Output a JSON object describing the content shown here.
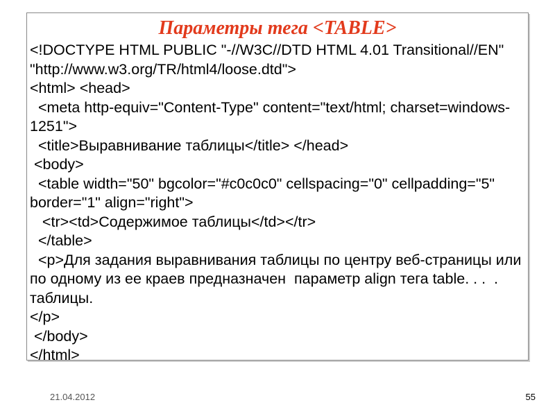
{
  "title": "Параметры тега <TABLE>",
  "code": "<!DOCTYPE HTML PUBLIC \"-//W3C//DTD HTML 4.01 Transitional//EN\" \"http://www.w3.org/TR/html4/loose.dtd\">\n<html> <head>\n  <meta http-equiv=\"Content-Type\" content=\"text/html; charset=windows-1251\">\n  <title>Выравнивание таблицы</title> </head>\n <body>\n  <table width=\"50\" bgcolor=\"#c0c0c0\" cellspacing=\"0\" cellpadding=\"5\" border=\"1\" align=\"right\">\n   <tr><td>Содержимое таблицы</td></tr>\n  </table>\n  <p>Для задания выравнивания таблицы по центру веб-страницы или по одному из ее краев предназначен  параметр align тега table. . .  . таблицы.\n</p>\n </body>\n</html>",
  "date": "21.04.2012",
  "page": "55"
}
